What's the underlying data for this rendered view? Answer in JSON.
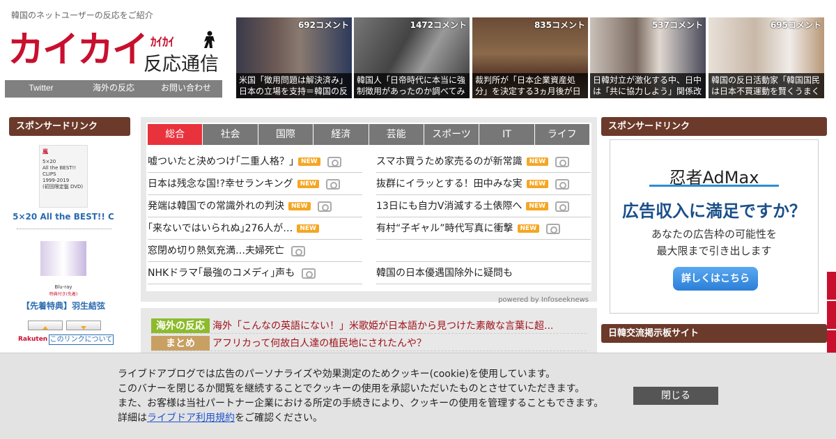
{
  "header": {
    "tagline": "韓国のネットユーザーの反応をご紹介",
    "logo_main": "カイカイ",
    "logo_kana": "ｶｲｶｲ",
    "logo_sub": "反応通信",
    "nav": [
      "Twitter",
      "海外の反応",
      "お問い合わせ"
    ]
  },
  "thumbs": [
    {
      "count": "692コメント",
      "caption": "米国「徴用問題は解決済み」日本の立場を支持＝韓国の反"
    },
    {
      "count": "1472コメント",
      "caption": "韓国人「日帝時代に本当に強制徴用があったのか調べてみ"
    },
    {
      "count": "835コメント",
      "caption": "裁判所が「日本企業資産処分」を決定する3ヵ月後が日"
    },
    {
      "count": "537コメント",
      "caption": "日韓対立が激化する中、日中は「共に協力しよう」関係改"
    },
    {
      "count": "695コメント",
      "caption": "韓国の反日活動家「韓国国民は日本不買運動を賢くうまく"
    }
  ],
  "left": {
    "heading": "スポンサードリンク",
    "product1_lines": [
      "嵐",
      "5×20",
      "All the BEST!!",
      "CLIPS",
      "1999-2019",
      "(初回限定盤 DVD)"
    ],
    "product1_title": "5×20 All the BEST!! C",
    "product2_small1": "Blu-ray",
    "product2_small2": "特典付き(先着)",
    "product2_title": "【先着特典】羽生結弦",
    "rakuten": "Rakuten",
    "about_link": "このリンクについて"
  },
  "tabs": [
    "総合",
    "社会",
    "国際",
    "経済",
    "芸能",
    "スポーツ",
    "IT",
    "ライフ"
  ],
  "news_left": [
    {
      "text": "嘘ついたと決めつけ｢二重人格？｣",
      "new": true,
      "cam": true
    },
    {
      "text": "日本は残念な国!?幸せランキング",
      "new": true,
      "cam": true
    },
    {
      "text": "発端は韓国での常識外れの判決",
      "new": true,
      "cam": true
    },
    {
      "text": "｢来ないではいられぬ｣276人が…",
      "new": true,
      "cam": false
    },
    {
      "text": "窓閉め切り熱気充満…夫婦死亡",
      "new": false,
      "cam": true
    },
    {
      "text": "NHKドラマ｢最強のコメディ｣声も",
      "new": false,
      "cam": true
    }
  ],
  "news_right": [
    {
      "text": "スマホ買うため家売るのが新常識",
      "new": true,
      "cam": true
    },
    {
      "text": "抜群にイラッとする！田中みな実",
      "new": true,
      "cam": true
    },
    {
      "text": "13日にも自力V消滅する土俵際へ",
      "new": true,
      "cam": true
    },
    {
      "text": "有村“子ギャル”時代写真に衝撃",
      "new": true,
      "cam": true
    },
    {
      "text": "",
      "new": false,
      "cam": false
    },
    {
      "text": "韓国の日本優遇国除外に疑問も",
      "new": false,
      "cam": false
    }
  ],
  "new_badge": "NEW",
  "powered": "powered by Infoseeknews",
  "blog_rows": [
    {
      "label": "海外の反応",
      "label_color": "#8cbb2b",
      "text": "海外「こんなの英語にない！」米歌姫が日本語から見つけた素敵な言葉に超..."
    },
    {
      "label": "まとめ",
      "label_color": "#c9a063",
      "text": "アフリカって何故白人達の植民地にされたんや？"
    }
  ],
  "right": {
    "heading": "スポンサードリンク",
    "ad_brand": "忍者AdMax",
    "ad_headline": "広告収入に満足ですか？",
    "ad_body1": "あなたの広告枠の可能性を",
    "ad_body2": "最大限まで引き出します",
    "ad_button": "詳しくはこちら",
    "heading2": "日韓交流掲示板サイト"
  },
  "cookie": {
    "line1": "ライブドアブログでは広告のパーソナライズや効果測定のためクッキー(cookie)を使用しています。",
    "line2": "このバナーを閉じるか閲覧を継続することでクッキーの使用を承認いただいたものとさせていただきます。",
    "line3": "また、お客様は当社パートナー企業における所定の手続きにより、クッキーの使用を管理することもできます。",
    "line4_pre": "詳細は",
    "line4_link": "ライブドア利用規約",
    "line4_post": "をご確認ください。",
    "close": "閉じる"
  },
  "colors": {
    "brand_red": "#c8102e",
    "sidebar_brown": "#6b3a2a",
    "tab_active": "#e8323c",
    "tab": "#777777"
  }
}
